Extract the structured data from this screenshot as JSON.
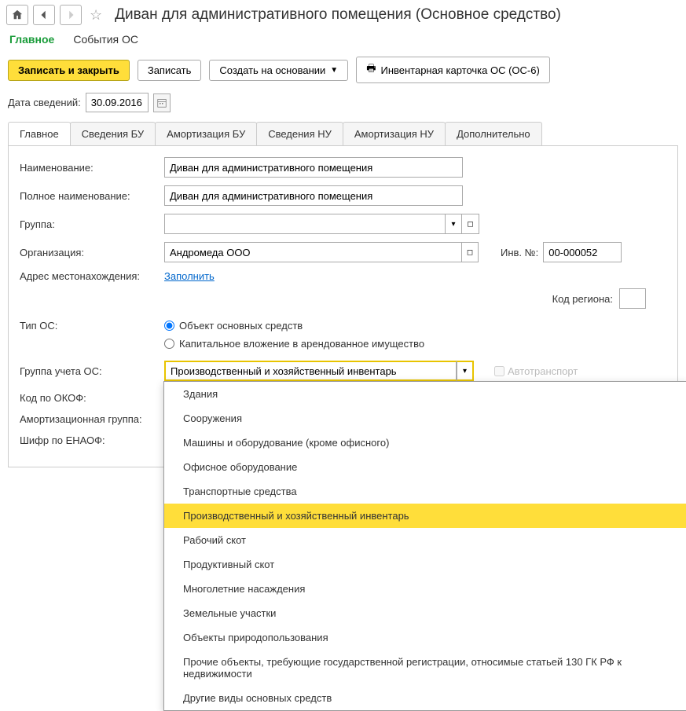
{
  "header": {
    "title": "Диван для административного помещения (Основное средство)"
  },
  "main_tabs": {
    "active": "Главное",
    "inactive": "События ОС"
  },
  "toolbar": {
    "save_close": "Записать и закрыть",
    "save": "Записать",
    "create_by": "Создать на основании",
    "inventory_card": "Инвентарная карточка ОС (ОС-6)"
  },
  "date": {
    "label": "Дата сведений:",
    "value": "30.09.2016"
  },
  "inner_tabs": [
    "Главное",
    "Сведения БУ",
    "Амортизация БУ",
    "Сведения НУ",
    "Амортизация НУ",
    "Дополнительно"
  ],
  "form": {
    "name_label": "Наименование:",
    "name_value": "Диван для административного помещения",
    "fullname_label": "Полное наименование:",
    "fullname_value": "Диван для административного помещения",
    "group_label": "Группа:",
    "group_value": "",
    "org_label": "Организация:",
    "org_value": "Андромеда ООО",
    "inv_label": "Инв. №:",
    "inv_value": "00-000052",
    "address_label": "Адрес местонахождения:",
    "address_link": "Заполнить",
    "region_label": "Код региона:",
    "type_label": "Тип ОС:",
    "type_opt1": "Объект основных средств",
    "type_opt2": "Капитальное вложение в арендованное имущество",
    "grp_label": "Группа учета ОС:",
    "grp_value": "Производственный и хозяйственный инвентарь",
    "auto_label": "Автотранспорт",
    "okof_label": "Код по ОКОФ:",
    "amort_label": "Амортизационная группа:",
    "enaof_label": "Шифр по ЕНАОФ:"
  },
  "dropdown": {
    "items": [
      "Здания",
      "Сооружения",
      "Машины и оборудование (кроме офисного)",
      "Офисное оборудование",
      "Транспортные средства",
      "Производственный и хозяйственный инвентарь",
      "Рабочий скот",
      "Продуктивный скот",
      "Многолетние насаждения",
      "Земельные участки",
      "Объекты природопользования",
      "Прочие объекты, требующие государственной регистрации, относимые статьей 130 ГК РФ к недвижимости",
      "Другие виды основных средств"
    ],
    "selected_index": 5
  }
}
